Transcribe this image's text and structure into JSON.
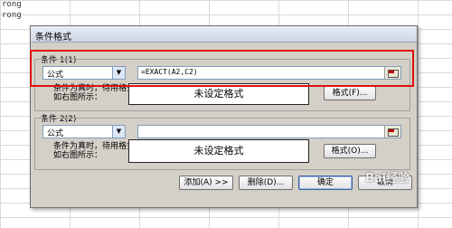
{
  "sheet": {
    "cell_a1": "rong",
    "cell_a2": "rong"
  },
  "dialog": {
    "title": "条件格式",
    "condition1": {
      "label": "条件 1(1)",
      "type_value": "公式",
      "formula": "=EXACT(A2,C2)",
      "description": "条件为真时，待用格式如右图所示：",
      "preview": "未设定格式",
      "format_button": "格式(F)..."
    },
    "condition2": {
      "label": "条件 2(2)",
      "type_value": "公式",
      "formula": "",
      "description": "条件为真时，待用格式如右图所示：",
      "preview": "未设定格式",
      "format_button": "格式(O)..."
    },
    "buttons": {
      "add": "添加(A) >>",
      "delete": "删除(D)...",
      "ok": "确定",
      "cancel": "取消"
    }
  },
  "watermark": "Bai经验"
}
